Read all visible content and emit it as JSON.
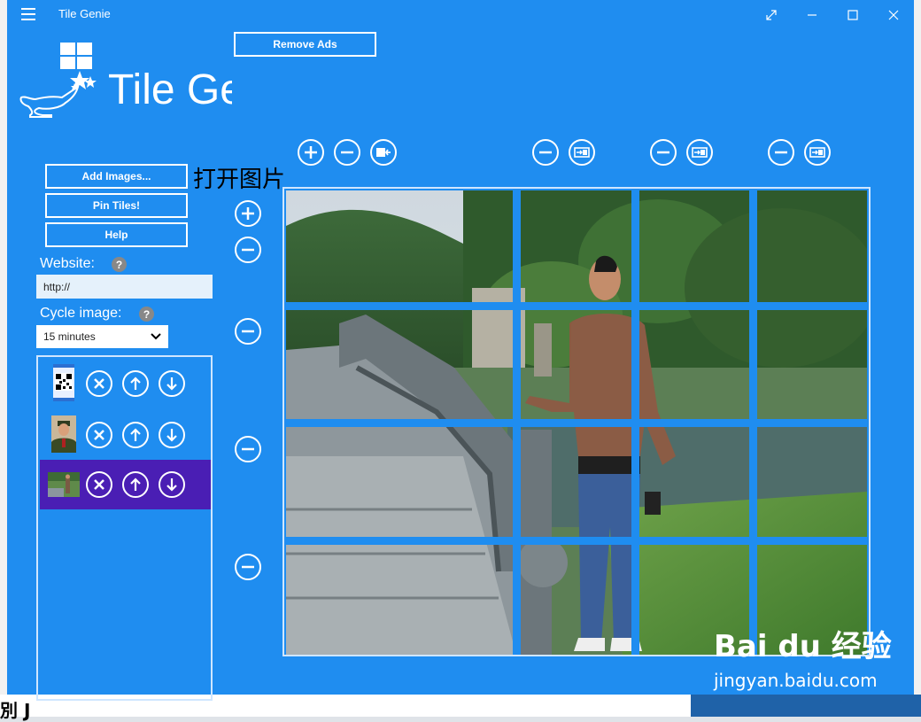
{
  "window": {
    "title": "Tile Genie"
  },
  "titlebar_icons": {
    "menu": "hamburger-icon",
    "fullscreen": "expand-icon",
    "minimize": "minimize-icon",
    "maximize": "maximize-icon",
    "close": "close-icon"
  },
  "header": {
    "logo_text": "Tile Gei",
    "remove_ads_label": "Remove Ads"
  },
  "sidebar": {
    "add_images_label": "Add Images...",
    "pin_tiles_label": "Pin Tiles!",
    "help_label": "Help",
    "annotation": "打开图片",
    "website_label": "Website:",
    "website_value": "http://",
    "cycle_label": "Cycle image:",
    "cycle_value": "15 minutes",
    "help_glyph": "?"
  },
  "image_list": [
    {
      "name": "qr-code-image",
      "selected": false
    },
    {
      "name": "uniform-portrait-image",
      "selected": false
    },
    {
      "name": "park-photo-image",
      "selected": true
    }
  ],
  "grid": {
    "columns": 4,
    "rows": 4
  },
  "colors": {
    "window": "#1f8df0",
    "selected_row": "#4a1eb4",
    "divider": "#1f8df0"
  },
  "watermark": {
    "brand": "Bai du 经验",
    "url": "jingyan.baidu.com"
  },
  "background": {
    "bottom_text": "別 J"
  }
}
